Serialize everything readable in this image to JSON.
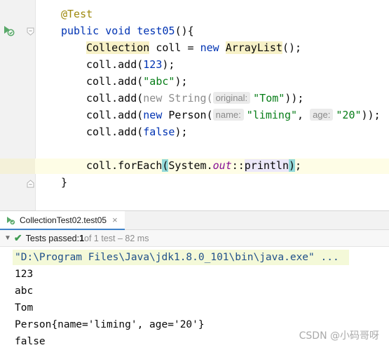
{
  "editor": {
    "lines": [
      {
        "annotation": "@Test"
      },
      {
        "kw": "public",
        "ret": "void",
        "name": "test05",
        "open": "(){"
      },
      {
        "type": "Collection",
        "decl": " coll = ",
        "kw_new": "new",
        "ctor": "ArrayList",
        "end": "();"
      },
      {
        "call": "coll.add(",
        "arg": "123",
        "end": ");"
      },
      {
        "call": "coll.add(",
        "arg": "\"abc\"",
        "end": ");"
      },
      {
        "call": "coll.add(",
        "kw_new": "new",
        "cls": " String(",
        "hint": "original:",
        "arg": "\"Tom\"",
        "end": "));"
      },
      {
        "call": "coll.add(",
        "kw_new": "new",
        "cls": " Person(",
        "hint1": "name:",
        "arg1": "\"liming\"",
        "sep": ", ",
        "hint2": "age:",
        "arg2": "\"20\"",
        "end": "));"
      },
      {
        "call": "coll.add(",
        "arg": "false",
        "end": ");"
      },
      {
        "call": "coll.forEach",
        "lp": "(",
        "sys": "System.",
        "field": "out",
        "sep": "::",
        "ref": "println",
        "rp": ")",
        "end": ";"
      },
      {
        "close": "}"
      }
    ],
    "icons": {
      "run": "run-test-icon",
      "fold": "fold-marker-icon"
    }
  },
  "run_panel": {
    "tab_label": "CollectionTest02.test05",
    "tab_close": "×",
    "status_prefix": "Tests passed: ",
    "status_count": "1",
    "status_detail": " of 1 test – 82 ms",
    "check_color": "#3e9b50"
  },
  "console": {
    "command": "\"D:\\Program Files\\Java\\jdk1.8.0_101\\bin\\java.exe\" ...",
    "output": [
      "123",
      "abc",
      "Tom",
      "Person{name='liming', age='20'}",
      "false"
    ]
  },
  "watermark": "CSDN @小码哥呀"
}
